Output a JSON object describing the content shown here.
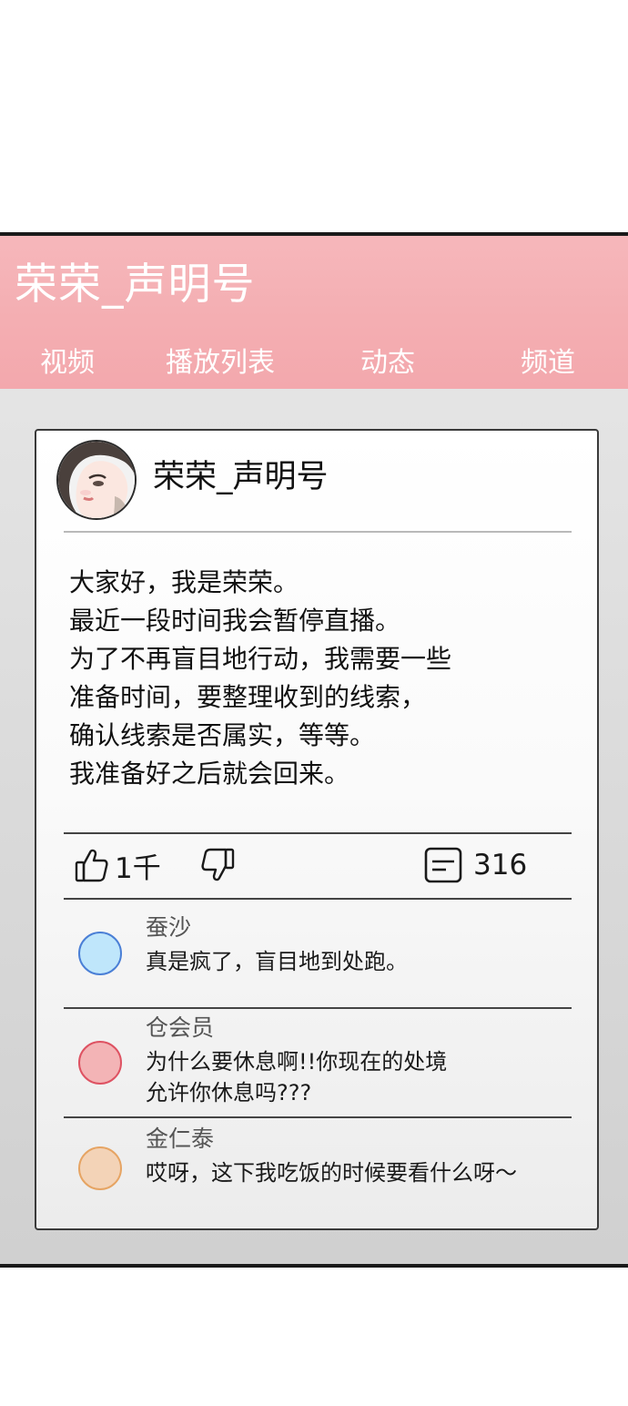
{
  "channel": {
    "title": "荣荣_声明号",
    "tabs": [
      "视频",
      "播放列表",
      "动态",
      "频道"
    ]
  },
  "post": {
    "author": "荣荣_声明号",
    "lines": [
      "大家好，我是荣荣。",
      "最近一段时间我会暂停直播。",
      "为了不再盲目地行动，我需要一些",
      "准备时间，要整理收到的线索，",
      "确认线索是否属实，等等。",
      "我准备好之后就会回来。"
    ],
    "likes": "1千",
    "comment_count": "316"
  },
  "comments": [
    {
      "author": "蚕沙",
      "lines": [
        "真是疯了，盲目地到处跑。"
      ],
      "avatar_color": "#bfe6fb",
      "avatar_border": "#4a7fd6"
    },
    {
      "author": "仓会员",
      "lines": [
        "为什么要休息啊!!你现在的处境",
        "允许你休息吗???"
      ],
      "avatar_color": "#f3b4b6",
      "avatar_border": "#de5262"
    },
    {
      "author": "金仁泰",
      "lines": [
        "哎呀，这下我吃饭的时候要看什么呀～"
      ],
      "avatar_color": "#f3d3b7",
      "avatar_border": "#e6a463"
    }
  ],
  "icons": {
    "like": "thumbs-up-icon",
    "dislike": "thumbs-down-icon",
    "comments": "comment-icon"
  },
  "colors": {
    "header": "#f4aeb2",
    "panel": "#dcdcdc"
  }
}
